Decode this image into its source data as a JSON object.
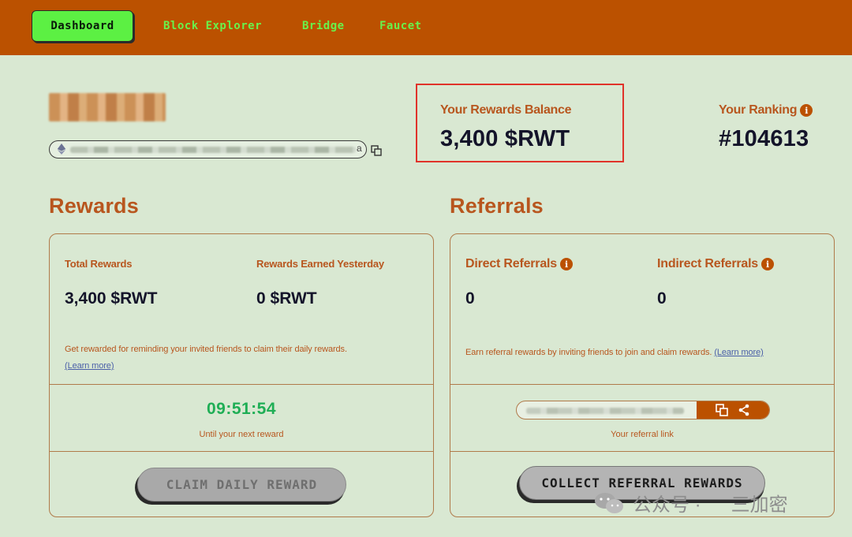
{
  "nav": {
    "items": [
      {
        "label": "Dashboard",
        "active": true
      },
      {
        "label": "Block Explorer",
        "active": false
      },
      {
        "label": "Bridge",
        "active": false
      },
      {
        "label": "Faucet",
        "active": false
      }
    ]
  },
  "profile": {
    "address_tail": "a"
  },
  "balance": {
    "label": "Your Rewards Balance",
    "value": "3,400 $RWT"
  },
  "ranking": {
    "label": "Your Ranking",
    "value": "#104613"
  },
  "rewards": {
    "title": "Rewards",
    "total_label": "Total Rewards",
    "total_value": "3,400 $RWT",
    "yesterday_label": "Rewards Earned Yesterday",
    "yesterday_value": "0 $RWT",
    "description": "Get rewarded for reminding your invited friends to claim their daily rewards.",
    "learn_more": "(Learn more)",
    "timer": "09:51:54",
    "timer_caption": "Until your next reward",
    "claim_button": "CLAIM DAILY REWARD"
  },
  "referrals": {
    "title": "Referrals",
    "direct_label": "Direct Referrals",
    "direct_value": "0",
    "indirect_label": "Indirect Referrals",
    "indirect_value": "0",
    "description": "Earn referral rewards by inviting friends to join and claim rewards.",
    "learn_more": "(Learn more)",
    "link_caption": "Your referral link",
    "collect_button": "COLLECT REFERRAL REWARDS"
  },
  "watermark": {
    "text_left": "公众号 ·",
    "text_right": "三加密"
  },
  "colors": {
    "topbar": "#bb5100",
    "accent_orange": "#b8561e",
    "active_nav": "#5cf043",
    "timer_green": "#1fae55",
    "highlight_border": "#e0332a",
    "background": "#d9e8d2"
  },
  "icons": [
    "ethereum-icon",
    "copy-icon",
    "info-icon",
    "share-icon",
    "wechat-icon"
  ]
}
